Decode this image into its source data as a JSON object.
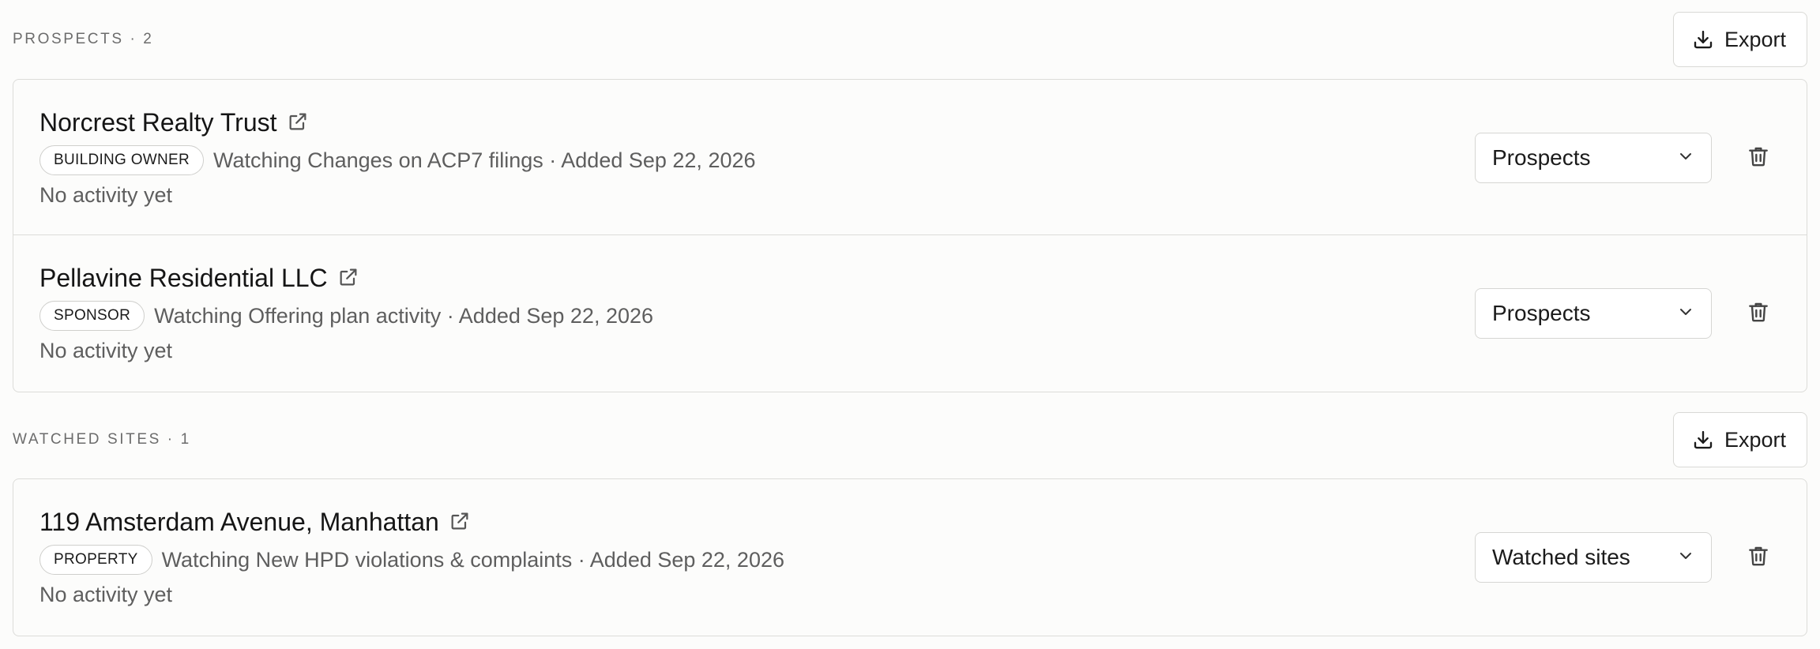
{
  "sections": [
    {
      "title": "PROSPECTS · 2",
      "export_label": "Export",
      "rows": [
        {
          "name": "Norcrest Realty Trust",
          "badge": "BUILDING OWNER",
          "meta": "Watching Changes on ACP7 filings · Added Sep 22, 2026",
          "activity": "No activity yet",
          "list": "Prospects"
        },
        {
          "name": "Pellavine Residential LLC",
          "badge": "SPONSOR",
          "meta": "Watching Offering plan activity · Added Sep 22, 2026",
          "activity": "No activity yet",
          "list": "Prospects"
        }
      ]
    },
    {
      "title": "WATCHED SITES · 1",
      "export_label": "Export",
      "rows": [
        {
          "name": "119 Amsterdam Avenue, Manhattan",
          "badge": "PROPERTY",
          "meta": "Watching New HPD violations & complaints · Added Sep 22, 2026",
          "activity": "No activity yet",
          "list": "Watched sites"
        }
      ]
    }
  ],
  "icons": {
    "export": "download-icon",
    "external": "external-link-icon",
    "dropdown": "chevron-down-icon",
    "delete": "trash-icon"
  },
  "colors": {
    "background": "#fcfcfb",
    "border": "#dcdcd9",
    "text": "#1b1b1b",
    "muted": "#5e5e5e"
  }
}
